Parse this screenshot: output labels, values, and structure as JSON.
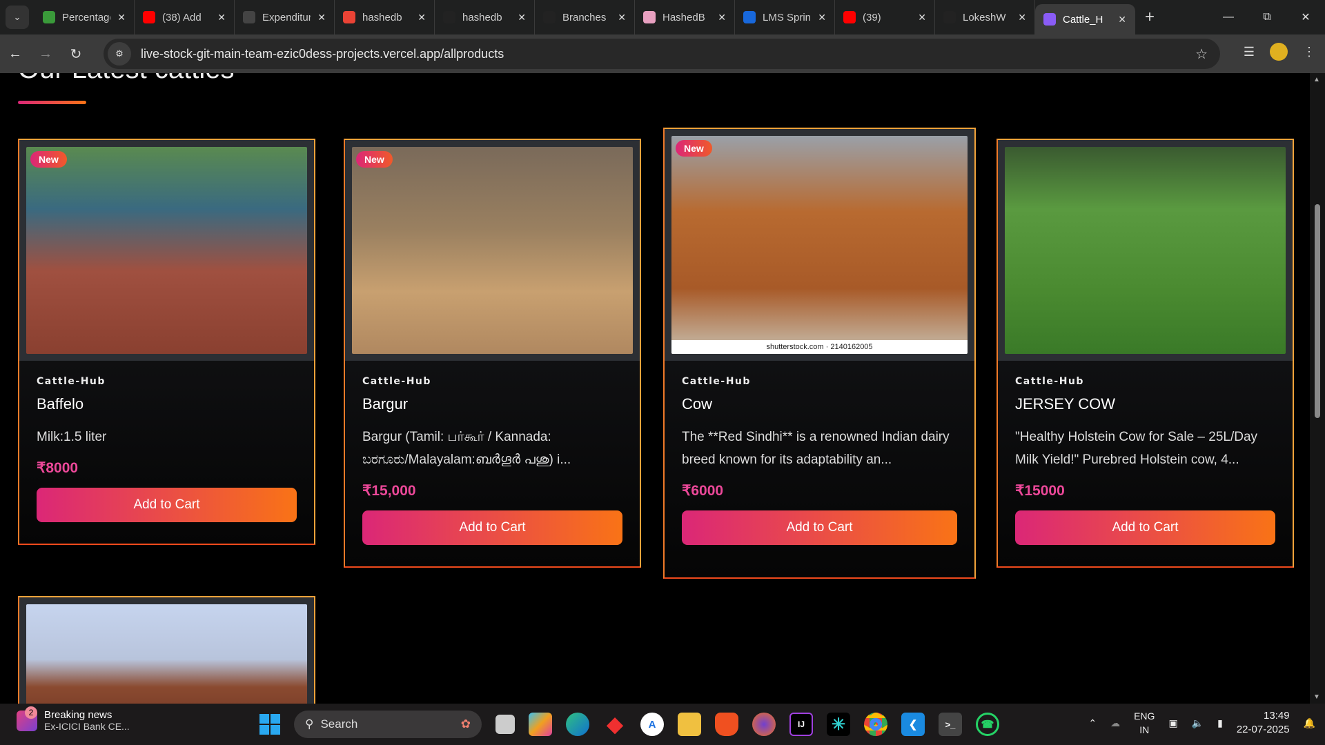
{
  "browser": {
    "tabs": [
      {
        "label": "Percentage",
        "icon": "plant-icon",
        "color": "#3a9a3a"
      },
      {
        "label": "(38) Add",
        "icon": "youtube-icon",
        "color": "#ff0000"
      },
      {
        "label": "Expenditure",
        "icon": "openai-icon",
        "color": "#444444"
      },
      {
        "label": "hashedb",
        "icon": "gmail-icon",
        "color": "#ea4335"
      },
      {
        "label": "hashedb",
        "icon": "github-icon",
        "color": "#222222"
      },
      {
        "label": "Branches",
        "icon": "github-icon",
        "color": "#222222"
      },
      {
        "label": "HashedB",
        "icon": "hashedbit-icon",
        "color": "#e8a0c0"
      },
      {
        "label": "LMS Sprint",
        "icon": "jira-icon",
        "color": "#1868db"
      },
      {
        "label": "(39)",
        "icon": "youtube-icon",
        "color": "#ff0000"
      },
      {
        "label": "LokeshW",
        "icon": "github-icon",
        "color": "#222222"
      },
      {
        "label": "Cattle_H",
        "icon": "vite-icon",
        "color": "#8a5cf6"
      }
    ],
    "url": "live-stock-git-main-team-ezic0dess-projects.vercel.app/allproducts"
  },
  "page": {
    "section_title": "Our Latest cattles",
    "products": [
      {
        "badge": "New",
        "brand": "Cattle-Hub",
        "name": "Baffelo",
        "description": "Milk:1.5 liter",
        "price": "₹8000",
        "button": "Add to Cart"
      },
      {
        "badge": "New",
        "brand": "Cattle-Hub",
        "name": "Bargur",
        "description": "Bargur (Tamil: பர்கூர் / Kannada: ಬರಗೂರು/Malayalam:ബർഗൂർ പശു) i...",
        "price": "₹15,000",
        "button": "Add to Cart"
      },
      {
        "badge": "New",
        "brand": "Cattle-Hub",
        "name": "Cow",
        "description": "The **Red Sindhi** is a renowned Indian dairy breed known for its adaptability an...",
        "price": "₹6000",
        "button": "Add to Cart",
        "watermark": "shutterstock.com · 2140162005"
      },
      {
        "brand": "Cattle-Hub",
        "name": "JERSEY COW",
        "description": "\"Healthy Holstein Cow for Sale – 25L/Day Milk Yield!\" Purebred Holstein cow, 4...",
        "price": "₹15000",
        "button": "Add to Cart"
      }
    ]
  },
  "taskbar": {
    "news_title": "Breaking news",
    "news_sub": "Ex-ICICI Bank CE...",
    "news_count": "2",
    "search_placeholder": "Search",
    "lang": "ENG",
    "region": "IN",
    "time": "13:49",
    "date": "22-07-2025"
  },
  "colors": {
    "accent_start": "#db2777",
    "accent_end": "#f97316",
    "price": "#ec4899",
    "card_border": "#f2a33a"
  }
}
